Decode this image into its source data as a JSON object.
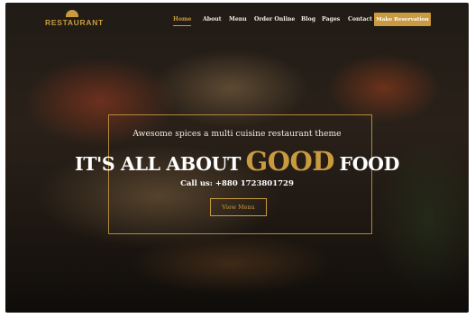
{
  "brand": {
    "logo_text": "RESTAURANT"
  },
  "nav": {
    "items": [
      {
        "label": "Home"
      },
      {
        "label": "About"
      },
      {
        "label": "Menu"
      },
      {
        "label": "Order Online"
      },
      {
        "label": "Blog"
      },
      {
        "label": "Pages"
      },
      {
        "label": "Contact"
      }
    ],
    "active": "Home",
    "cta_label": "Make Reservation"
  },
  "hero": {
    "tagline": "Awesome spices a multi cuisine restaurant theme",
    "headline_pre": "IT'S ALL ABOUT",
    "headline_highlight": "GOOD",
    "headline_post": "FOOD",
    "call_label": "Call us:",
    "phone": "+880 1723801729",
    "button_label": "View Menu"
  },
  "colors": {
    "accent": "#c99a3f",
    "text": "#ffffff"
  }
}
